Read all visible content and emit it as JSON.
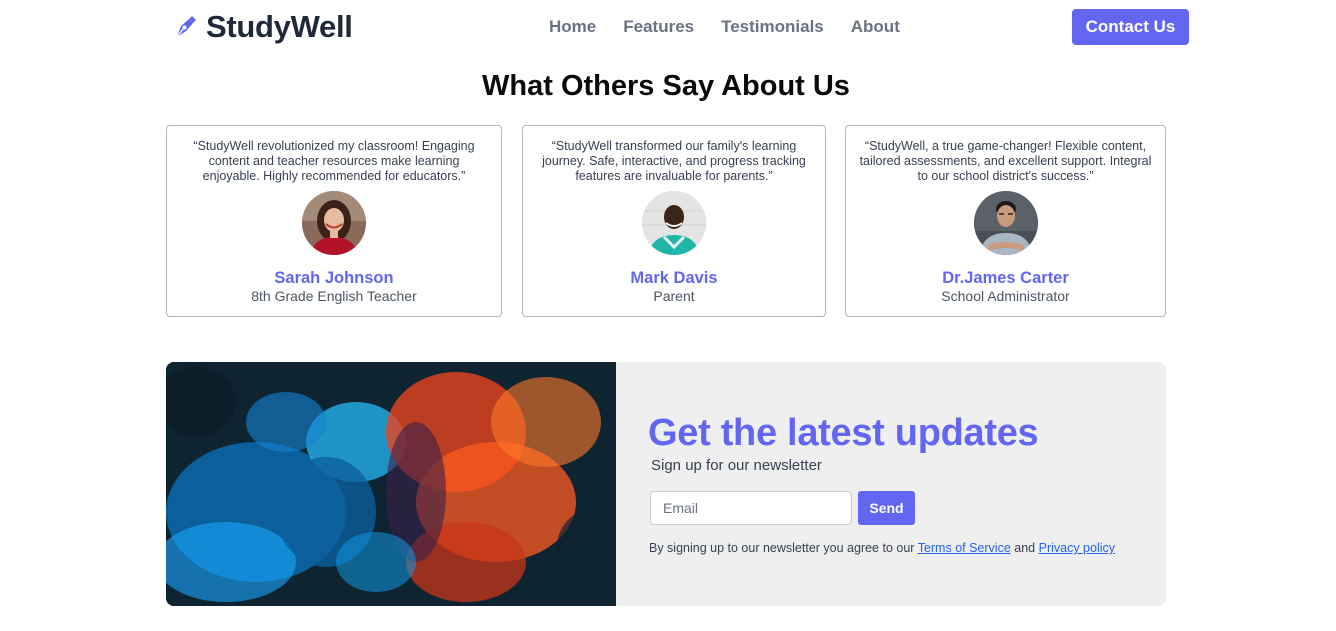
{
  "header": {
    "brand": "StudyWell",
    "nav": [
      "Home",
      "Features",
      "Testimonials",
      "About"
    ],
    "contact_label": "Contact Us"
  },
  "testimonials": {
    "title": "What Others Say About Us",
    "items": [
      {
        "quote": "“StudyWell revolutionized my classroom! Engaging content and teacher resources make learning enjoyable. Highly recommended for educators.”",
        "name": "Sarah Johnson",
        "role": "8th Grade English Teacher"
      },
      {
        "quote": "“StudyWell transformed our family's learning journey. Safe, interactive, and progress tracking features are invaluable for parents.”",
        "name": "Mark Davis",
        "role": "Parent"
      },
      {
        "quote": "“StudyWell, a true game-changer! Flexible content, tailored assessments, and excellent support. Integral to our school district's success.”",
        "name": "Dr.James Carter",
        "role": "School Administrator"
      }
    ]
  },
  "newsletter": {
    "heading": "Get the latest updates",
    "subheading": "Sign up for our newsletter",
    "email_placeholder": "Email",
    "send_label": "Send",
    "legal_prefix": "By signing up to our newsletter you agree to our",
    "terms_label": "Terms of Service",
    "legal_and": "and",
    "privacy_label": "Privacy policy"
  },
  "colors": {
    "accent": "#6366f1",
    "link": "#2563eb",
    "panel_bg": "#efefef"
  },
  "icons": {
    "brand": "pen-nib-icon"
  }
}
